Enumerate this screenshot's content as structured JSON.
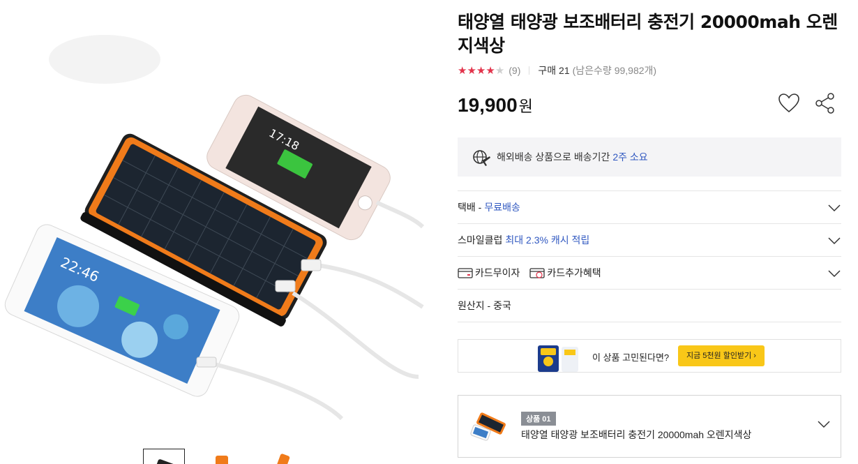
{
  "product": {
    "title": "태양열 태양광 보조배터리 충전기 20000mah 오렌지색상",
    "rating": {
      "stars": 4,
      "max_stars": 5,
      "review_count": "(9)"
    },
    "purchase_label": "구매 21",
    "stock_text": "(남은수량 99,982개)",
    "price_value": "19,900",
    "price_unit": "원"
  },
  "shipping": {
    "icon": "overseas-shipping-icon",
    "text": "해외배송 상품으로 배송기간",
    "highlight": "2주 소요"
  },
  "options": {
    "delivery": {
      "label": "택배 -",
      "value": "무료배송"
    },
    "smile_club": {
      "label": "스마일클럽",
      "value": "최대 2.3% 캐시 적립"
    },
    "card_no_interest": {
      "label": "카드무이자"
    },
    "card_benefit": {
      "label": "카드추가혜택"
    },
    "origin": {
      "label": "원산지 - 중국"
    }
  },
  "promo": {
    "question": "이 상품 고민된다면?",
    "button": "지금 5천원 할인받기 ›"
  },
  "selected_item": {
    "badge": "상품 01",
    "name": "태양열 태양광 보조배터리 충전기 20000mah 오렌지색상"
  },
  "colors": {
    "accent_blue": "#2f57c0",
    "star_red": "#e2334b",
    "promo_yellow": "#f9c718"
  }
}
